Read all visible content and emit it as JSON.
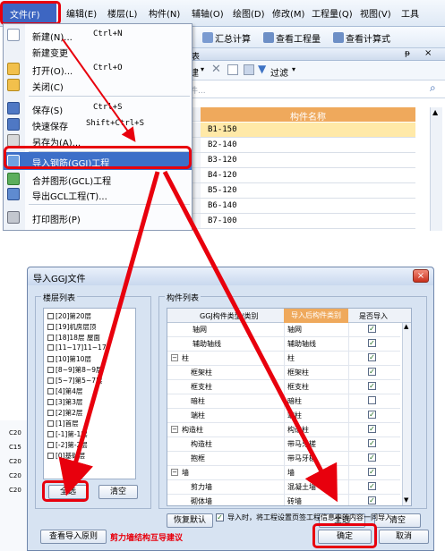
{
  "menubar": {
    "items": [
      "文件(F)",
      "编辑(E)",
      "楼层(L)",
      "构件(N)",
      "辅轴(O)",
      "绘图(D)",
      "修改(M)",
      "工程量(Q)",
      "视图(V)",
      "工具"
    ]
  },
  "toolbar": {
    "sum_label": "汇总计算",
    "view_qty_label": "查看工程量",
    "view_formula_label": "查看计算式"
  },
  "file_menu": {
    "items": [
      {
        "label": "新建(N)...",
        "shortcut": "Ctrl+N"
      },
      {
        "label": "新建变更",
        "shortcut": ""
      },
      {
        "label": "打开(O)...",
        "shortcut": "Ctrl+O"
      },
      {
        "label": "关闭(C)",
        "shortcut": ""
      },
      {
        "label": "保存(S)",
        "shortcut": "Ctrl+S"
      },
      {
        "label": "快速保存",
        "shortcut": "Shift+Ctrl+S"
      },
      {
        "label": "另存为(A)...",
        "shortcut": ""
      },
      {
        "label": "导入钢筋(GGJ)工程",
        "shortcut": ""
      },
      {
        "label": "合并图形(GCL)工程",
        "shortcut": ""
      },
      {
        "label": "导出GCL工程(T)...",
        "shortcut": ""
      },
      {
        "label": "打印图形(P)",
        "shortcut": ""
      }
    ]
  },
  "panel": {
    "title": "表",
    "tools": [
      "建",
      "过滤"
    ],
    "search_placeholder": "件...",
    "column_header": "构件名称",
    "rows": [
      "B1-150",
      "B2-140",
      "B3-120",
      "B4-120",
      "B5-120",
      "B6-140",
      "B7-100"
    ]
  },
  "background_cells": [
    "C20",
    "C15",
    "C20",
    "C20",
    "C20"
  ],
  "dialog": {
    "title": "导入GGJ文件",
    "close": "×",
    "floor_group_title": "楼层列表",
    "floors": [
      "[20]第20层",
      "[19]机房层顶",
      "[18]18层 屋面",
      "[11~17]11~17",
      "[10]第10层",
      "[8~9]第8~9层",
      "[5~7]第5~7层",
      "[4]第4层",
      "[3]第3层",
      "[2]第2层",
      "[1]首层",
      "[-1]第-1层",
      "[-2]第-2层",
      "[0]基础层"
    ],
    "floor_select_all": "全选",
    "floor_clear": "清空",
    "comp_group_title": "构件列表",
    "col_ggj": "GGJ构件类型/类别",
    "col_after": "导入后构件类别",
    "col_import": "是否导入",
    "components": [
      {
        "name": "轴网",
        "after": "轴网",
        "checked": true,
        "expander": "",
        "level": 0
      },
      {
        "name": "辅助轴线",
        "after": "辅助轴线",
        "checked": true,
        "expander": "",
        "level": 0
      },
      {
        "name": "柱",
        "after": "柱",
        "checked": true,
        "expander": "−",
        "level": 0
      },
      {
        "name": "框架柱",
        "after": "框架柱",
        "checked": true,
        "expander": "",
        "level": 1
      },
      {
        "name": "框支柱",
        "after": "框支柱",
        "checked": true,
        "expander": "",
        "level": 1
      },
      {
        "name": "暗柱",
        "after": "暗柱",
        "checked": false,
        "expander": "",
        "level": 1
      },
      {
        "name": "端柱",
        "after": "端柱",
        "checked": true,
        "expander": "",
        "level": 1
      },
      {
        "name": "构造柱",
        "after": "构造柱",
        "checked": true,
        "expander": "−",
        "level": 0
      },
      {
        "name": "构造柱",
        "after": "带马牙槎",
        "checked": true,
        "expander": "",
        "level": 1
      },
      {
        "name": "抱框",
        "after": "带马牙槎",
        "checked": true,
        "expander": "",
        "level": 1
      },
      {
        "name": "墙",
        "after": "墙",
        "checked": true,
        "expander": "−",
        "level": 0
      },
      {
        "name": "剪力墙",
        "after": "混凝土墙",
        "checked": true,
        "expander": "",
        "level": 1
      },
      {
        "name": "砌体墙",
        "after": "砖墙",
        "checked": true,
        "expander": "",
        "level": 1
      }
    ],
    "restore_default": "恢复默认",
    "comp_select_all": "全选",
    "comp_clear": "清空",
    "import_option_label": "导入时，将工程设置页签工程信息中的内容一同导入",
    "import_option_checked": true,
    "view_rules": "查看导入原则",
    "shear_wall_note": "剪力墙结构互导建议",
    "ok": "确定",
    "cancel": "取消"
  },
  "colors": {
    "highlight_red": "#e8000d",
    "menu_selected_blue": "#3d6fc8",
    "header_orange": "#efa95c"
  }
}
